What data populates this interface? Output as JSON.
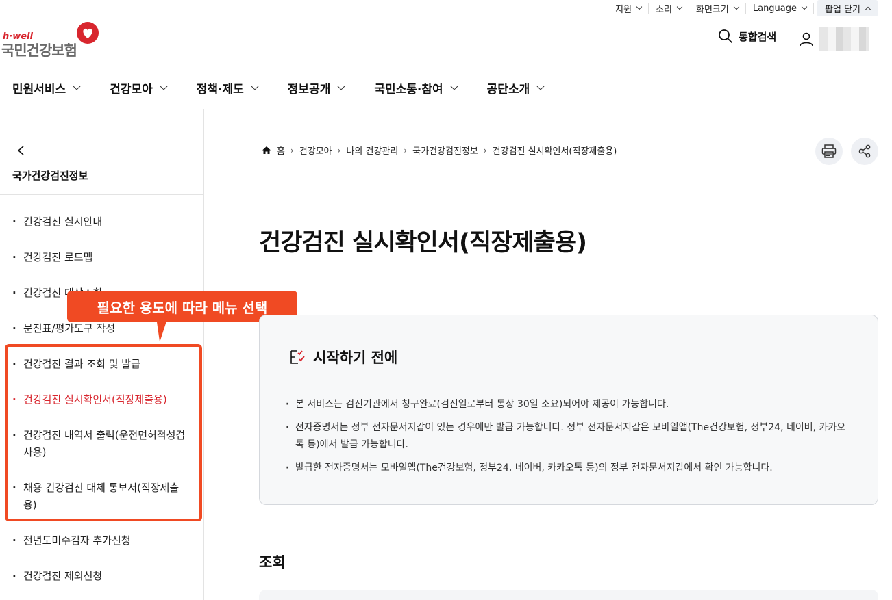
{
  "utility": {
    "support": "지원",
    "sound": "소리",
    "screen_size": "화면크기",
    "language": "Language",
    "popup_close": "팝업 닫기"
  },
  "logo": {
    "small": "h·well",
    "main": "국민건강보험"
  },
  "header": {
    "search_label": "통합검색"
  },
  "gnb": [
    "민원서비스",
    "건강모아",
    "정책·제도",
    "정보공개",
    "국민소통·참여",
    "공단소개"
  ],
  "sidebar": {
    "title": "국가건강검진정보",
    "items": [
      {
        "label": "건강검진 실시안내",
        "active": false
      },
      {
        "label": "건강검진 로드맵",
        "active": false
      },
      {
        "label": "건강검진 대상조회",
        "active": false
      },
      {
        "label": "문진표/평가도구 작성",
        "active": false
      },
      {
        "label": "건강검진 결과 조회 및 발급",
        "active": false
      },
      {
        "label": "건강검진 실시확인서(직장제출용)",
        "active": true
      },
      {
        "label": "건강검진 내역서 출력(운전면허적성검사용)",
        "active": false
      },
      {
        "label": "채용 건강검진 대체 통보서(직장제출용)",
        "active": false
      },
      {
        "label": "전년도미수검자 추가신청",
        "active": false
      },
      {
        "label": "건강검진 제외신청",
        "active": false
      }
    ]
  },
  "annotation": {
    "callout": "필요한 용도에 따라 메뉴 선택",
    "color": "#f04a23"
  },
  "breadcrumb": [
    "홈",
    "건강모아",
    "나의 건강관리",
    "국가건강검진정보",
    "건강검진 실시확인서(직장제출용)"
  ],
  "main": {
    "title": "건강검진 실시확인서(직장제출용)",
    "info_heading": "시작하기 전에",
    "info_items": [
      "본 서비스는 검진기관에서 청구완료(검진일로부터 통상 30일 소요)되어야 제공이 가능합니다.",
      "전자증명서는 정부 전자문서지갑이 있는 경우에만 발급 가능합니다. 정부 전자문서지갑은 모바일앱(The건강보험, 정부24, 네이버, 카카오톡 등)에서 발급 가능합니다.",
      "발급한 전자증명서는 모바일앱(The건강보험, 정부24, 네이버, 카카오톡 등)의 정부 전자문서지갑에서 확인 가능합니다."
    ],
    "section_title": "조회"
  },
  "colors": {
    "brand_red": "#d8262e",
    "active_menu": "#d8262e"
  }
}
